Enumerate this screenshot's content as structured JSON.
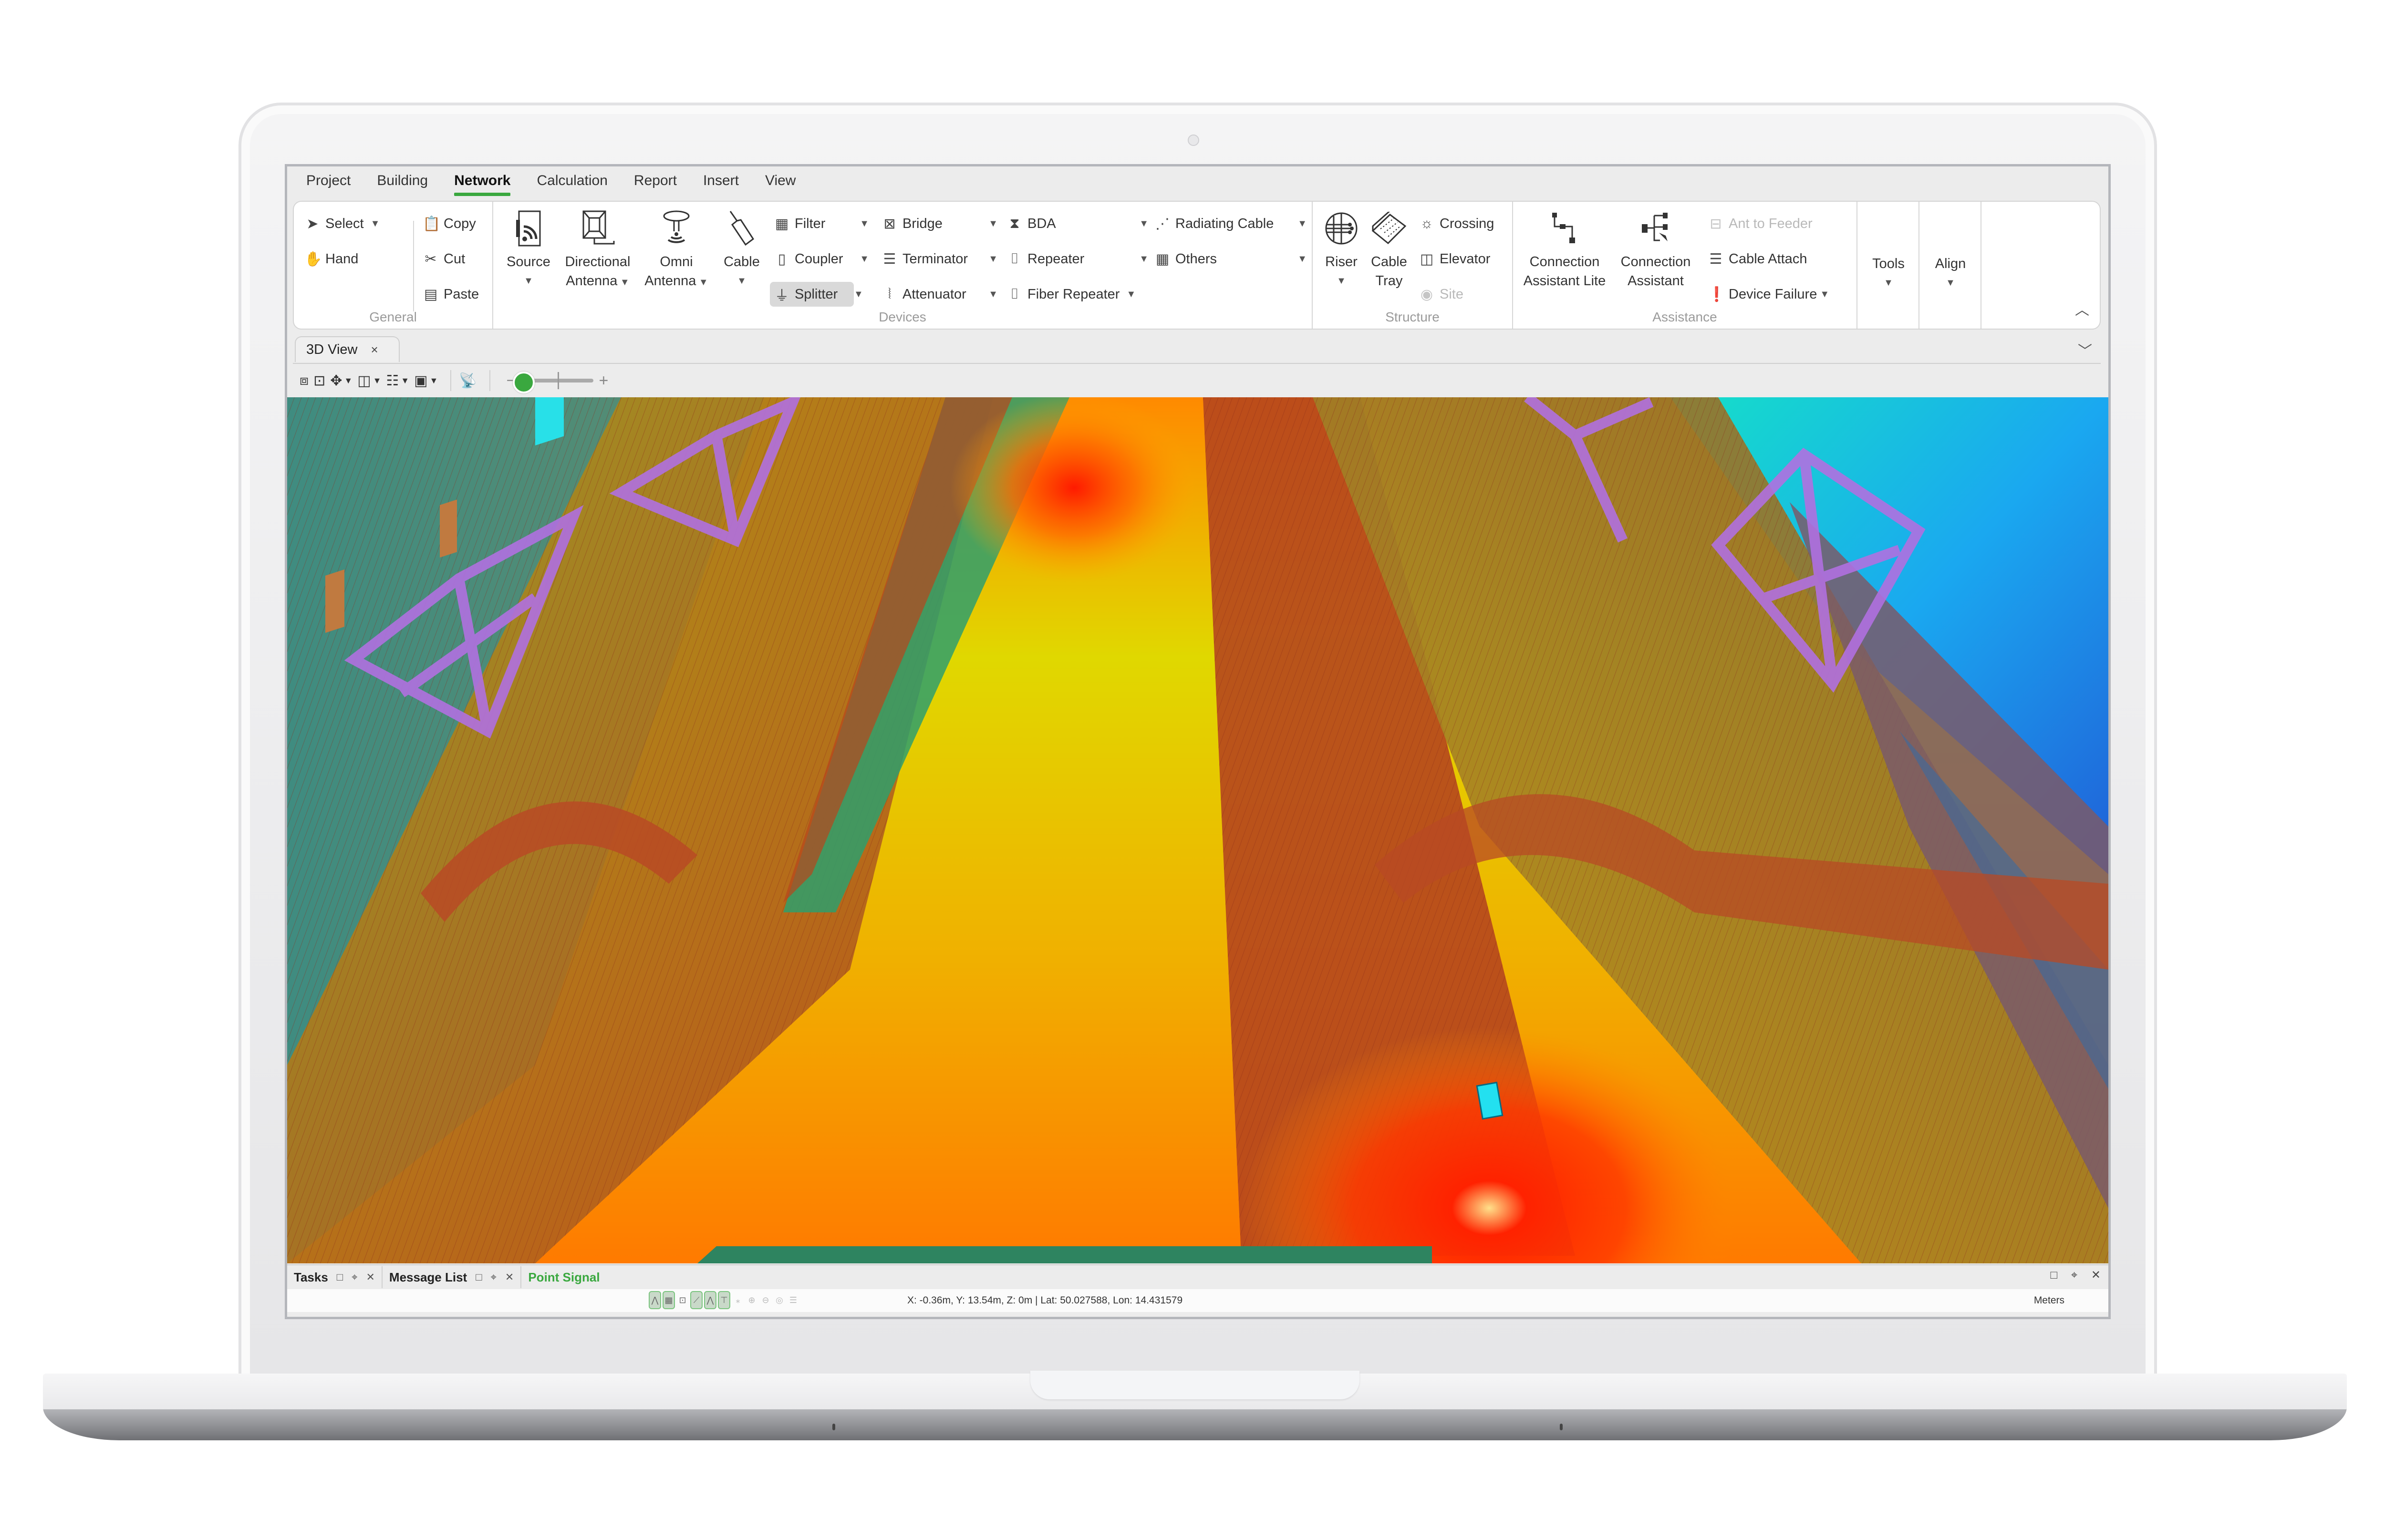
{
  "app": {
    "menu": [
      "Project",
      "Building",
      "Network",
      "Calculation",
      "Report",
      "Insert",
      "View"
    ],
    "active_menu": "Network",
    "accent_color": "#3aa83f"
  },
  "ribbon": {
    "general": {
      "label": "General",
      "select": "Select",
      "hand": "Hand",
      "copy": "Copy",
      "cut": "Cut",
      "paste": "Paste"
    },
    "devices": {
      "label": "Devices",
      "source": "Source",
      "directional_antenna": [
        "Directional",
        "Antenna"
      ],
      "omni_antenna": [
        "Omni",
        "Antenna"
      ],
      "cable": "Cable",
      "col1": [
        "Filter",
        "Coupler",
        "Splitter"
      ],
      "col2": [
        "Bridge",
        "Terminator",
        "Attenuator"
      ],
      "col3": [
        "BDA",
        "Repeater",
        "Fiber Repeater"
      ],
      "col4": [
        "Radiating Cable",
        "Others"
      ],
      "selected_item": "Splitter"
    },
    "structure": {
      "label": "Structure",
      "riser": "Riser",
      "cable_tray": [
        "Cable",
        "Tray"
      ],
      "crossing": "Crossing",
      "elevator": "Elevator",
      "site": "Site"
    },
    "assistance": {
      "label": "Assistance",
      "connection_assistant_lite": [
        "Connection",
        "Assistant Lite"
      ],
      "connection_assistant": [
        "Connection",
        "Assistant"
      ],
      "ant_to_feeder": "Ant to Feeder",
      "cable_attach": "Cable Attach",
      "device_failure": "Device Failure"
    },
    "tools": "Tools",
    "align": "Align"
  },
  "document_tab": {
    "label": "3D View",
    "close": "×"
  },
  "view_toolbar": {
    "zoom_level": 0.0
  },
  "bottom_panel": {
    "tabs": [
      {
        "label": "Tasks"
      },
      {
        "label": "Message List"
      },
      {
        "label": "Point Signal"
      }
    ]
  },
  "statusbar": {
    "coordinates": "X: -0.36m, Y: 13.54m, Z: 0m | Lat: 50.027588, Lon: 14.431579",
    "units": "Meters"
  }
}
